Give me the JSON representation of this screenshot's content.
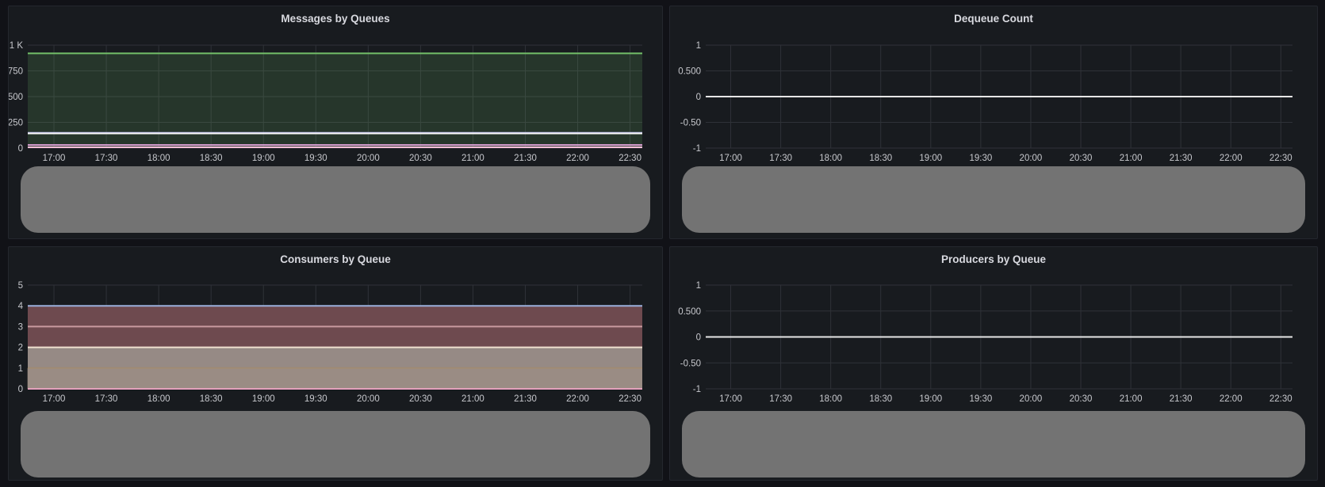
{
  "panels": [
    {
      "id": "p1",
      "title": "Messages by Queues"
    },
    {
      "id": "p2",
      "title": "Dequeue Count"
    },
    {
      "id": "p3",
      "title": "Consumers by Queue"
    },
    {
      "id": "p4",
      "title": "Producers by Queue"
    }
  ],
  "chart_data": [
    {
      "type": "area",
      "title": "Messages by Queues",
      "x": [
        "17:00",
        "17:30",
        "18:00",
        "18:30",
        "19:00",
        "19:30",
        "20:00",
        "20:30",
        "21:00",
        "21:30",
        "22:00",
        "22:30"
      ],
      "y_ticks": [
        "0",
        "250",
        "500",
        "750",
        "1 K"
      ],
      "ylim": [
        0,
        1000
      ],
      "xlim_minutes": [
        -15,
        337
      ],
      "series": [
        {
          "color": "#73bf69",
          "constant": 920,
          "fill": true
        },
        {
          "color": "#b4b4f0",
          "constant": 148
        },
        {
          "color": "#f5f5f5",
          "constant": 142
        },
        {
          "color": "#e0a3d8",
          "constant": 30
        },
        {
          "color": "#f5c0d8",
          "constant": 8
        }
      ],
      "grid": true
    },
    {
      "type": "line",
      "title": "Dequeue Count",
      "x": [
        "17:00",
        "17:30",
        "18:00",
        "18:30",
        "19:00",
        "19:30",
        "20:00",
        "20:30",
        "21:00",
        "21:30",
        "22:00",
        "22:30"
      ],
      "y_ticks": [
        "-1",
        "-0.50",
        "0",
        "0.500",
        "1"
      ],
      "ylim": [
        -1,
        1
      ],
      "xlim_minutes": [
        -15,
        337
      ],
      "series": [
        {
          "color": "#e6e6e6",
          "constant": 0
        }
      ],
      "grid": true
    },
    {
      "type": "area",
      "title": "Consumers by Queue",
      "x": [
        "17:00",
        "17:30",
        "18:00",
        "18:30",
        "19:00",
        "19:30",
        "20:00",
        "20:30",
        "21:00",
        "21:30",
        "22:00",
        "22:30"
      ],
      "y_ticks": [
        "0",
        "1",
        "2",
        "3",
        "4",
        "5"
      ],
      "ylim": [
        0,
        5
      ],
      "xlim_minutes": [
        -15,
        337
      ],
      "series": [
        {
          "color": "#9bb0dc",
          "constant": 4,
          "fill": true,
          "fill_color": "#6e4a4f"
        },
        {
          "color": "#c99a9f",
          "constant": 3
        },
        {
          "color": "#f0e0d0",
          "constant": 2,
          "fill": true,
          "fill_color": "#968a85"
        },
        {
          "color": "#a08a70",
          "constant": 1
        },
        {
          "color": "#f2a6c8",
          "constant": 0
        }
      ],
      "grid": true
    },
    {
      "type": "line",
      "title": "Producers by Queue",
      "x": [
        "17:00",
        "17:30",
        "18:00",
        "18:30",
        "19:00",
        "19:30",
        "20:00",
        "20:30",
        "21:00",
        "21:30",
        "22:00",
        "22:30"
      ],
      "y_ticks": [
        "-1",
        "-0.50",
        "0",
        "0.500",
        "1"
      ],
      "ylim": [
        -1,
        1
      ],
      "xlim_minutes": [
        -15,
        337
      ],
      "series": [
        {
          "color": "#e6e6e6",
          "constant": 0
        }
      ],
      "grid": true
    }
  ]
}
